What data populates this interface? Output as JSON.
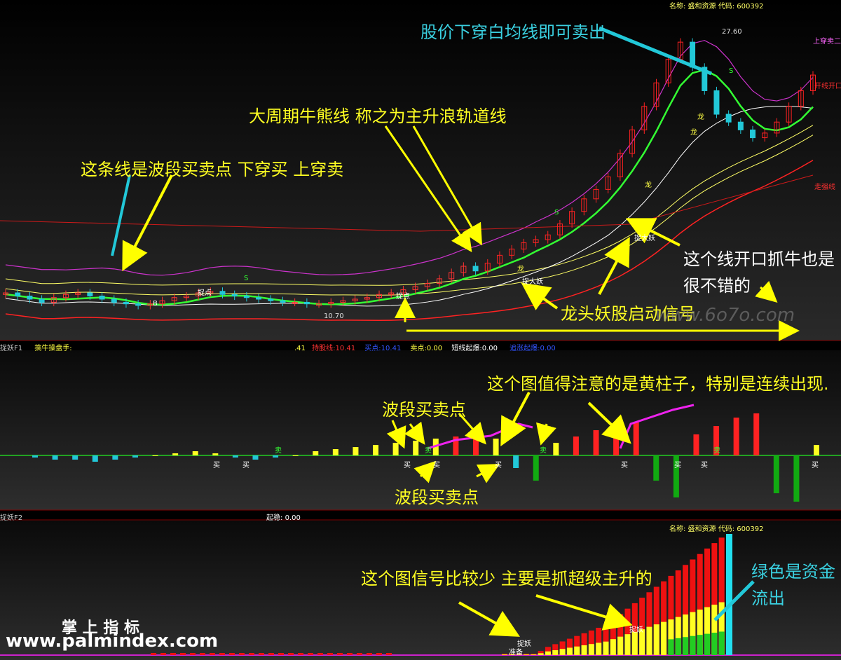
{
  "main_panel": {
    "header": "名称: 盛和资源 代码: 600392",
    "high_label": "27.60",
    "low_label": "10.70",
    "tag_top": "上穿卖二",
    "tag_open": "开线开口",
    "tag_mid": "走强线",
    "annotations": {
      "sell": "股价下穿白均线即可卖出",
      "track": "大周期牛熊线 称之为主升浪轨道线",
      "band": "这条线是波段买卖点 下穿买 上穿卖",
      "open1": "这个线开口抓牛也是",
      "open2": "很不错的",
      "dragon": "龙头妖股启动信号",
      "watermark": "www.6o7o.com"
    },
    "marks": {
      "dragon": "龙",
      "demon": "捉大妖",
      "start": "捉点",
      "buy": "买",
      "sell": "卖",
      "s": "S",
      "b": "B"
    }
  },
  "bar1": {
    "name": "捉妖F1",
    "title": "擒牛操盘手:",
    "v0": ".41",
    "label1": "持股线:",
    "val1": "10.41",
    "label2": "买点:",
    "val2": "10.41",
    "label3": "卖点:",
    "val3": "0.00",
    "label4": "短线起爆:",
    "val4": "0.00",
    "label5": "追涨起爆:",
    "val5": "0.00"
  },
  "panel2": {
    "annotations": {
      "yellow": "这个图值得注意的是黄柱子，特别是连续出现.",
      "wave1": "波段买卖点",
      "wave2": "波段买卖点"
    }
  },
  "bar2": {
    "name": "捉妖F2",
    "label": "起稳:",
    "val": "0.00"
  },
  "panel3": {
    "header": "名称: 盛和资源 代码: 600392",
    "annotations": {
      "signal": "这个图信号比较少 主要是抓超级主升的",
      "green1": "绿色是资金",
      "green2": "流出"
    },
    "marks": {
      "demon": "捉妖",
      "prepare": "准备"
    }
  },
  "watermark": {
    "cn": "掌 上 指 标",
    "url": "www.palmindex.com"
  },
  "chart_data": [
    {
      "type": "candlestick",
      "closes": [
        11.6,
        11.4,
        11.2,
        11.0,
        11.3,
        11.5,
        11.6,
        11.4,
        11.2,
        11.0,
        10.9,
        10.8,
        10.9,
        11.1,
        11.3,
        11.4,
        11.6,
        11.7,
        11.5,
        11.4,
        11.3,
        11.2,
        11.1,
        11.0,
        11.0,
        10.9,
        10.9,
        11.0,
        11.1,
        11.2,
        11.3,
        11.5,
        11.6,
        11.8,
        12.0,
        12.2,
        12.5,
        12.9,
        13.3,
        13.0,
        13.5,
        14.0,
        14.4,
        14.8,
        15.0,
        15.3,
        16.0,
        16.8,
        17.6,
        18.2,
        19.0,
        20.5,
        22.0,
        23.5,
        25.0,
        26.5,
        27.6,
        26.0,
        24.5,
        23.0,
        22.5,
        22.0,
        21.5,
        21.8,
        22.5,
        23.5,
        24.5,
        25.5
      ],
      "high": 27.6,
      "low": 10.7
    },
    {
      "type": "bar",
      "series": [
        {
          "values": [
            -1,
            -2,
            -2,
            -3,
            -2,
            -1,
            0,
            1,
            2,
            1,
            -1,
            -2,
            -1,
            0,
            2,
            3,
            4,
            5,
            6,
            7,
            8,
            9,
            10,
            8,
            -6,
            -12,
            6,
            9,
            12,
            14,
            16,
            -12,
            -20,
            10,
            14,
            18,
            20,
            -18,
            -22,
            5
          ]
        }
      ]
    },
    {
      "type": "bar",
      "series": [
        {
          "values": [
            1,
            1,
            1,
            1,
            1,
            3,
            6,
            8,
            10,
            12,
            14,
            16,
            18,
            20,
            22,
            26,
            30,
            34,
            38,
            42,
            46,
            50,
            54,
            58,
            62,
            66,
            70,
            74,
            78,
            82,
            86,
            88
          ]
        }
      ]
    }
  ]
}
